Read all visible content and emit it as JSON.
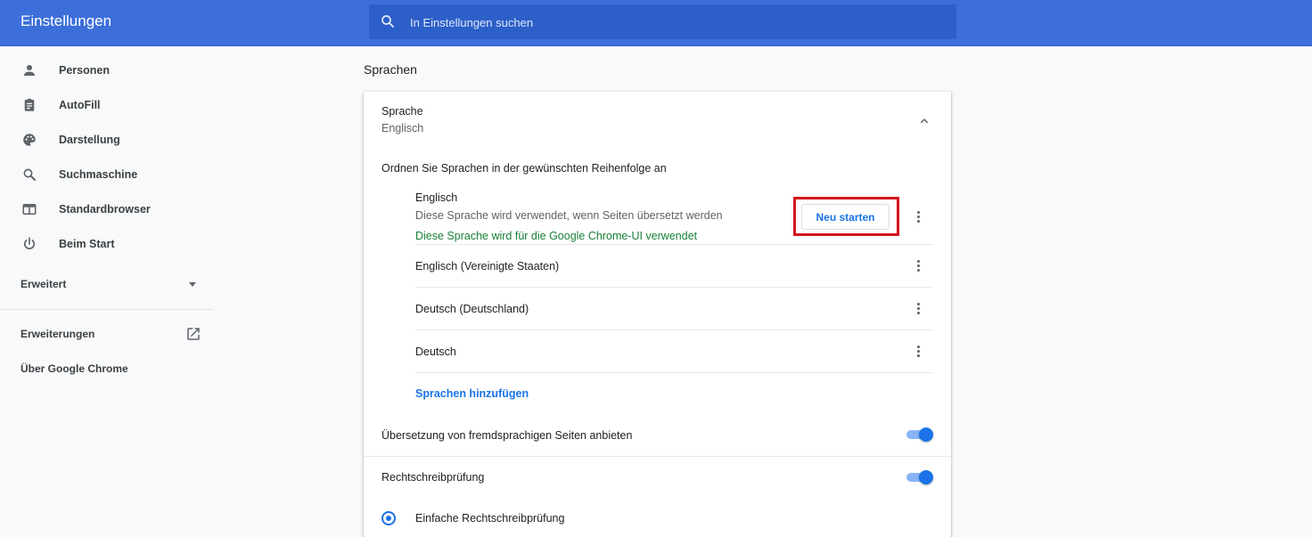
{
  "header": {
    "title": "Einstellungen",
    "search_placeholder": "In Einstellungen suchen"
  },
  "sidebar": {
    "items": [
      {
        "label": "Personen",
        "icon": "person-icon"
      },
      {
        "label": "AutoFill",
        "icon": "clipboard-icon"
      },
      {
        "label": "Darstellung",
        "icon": "palette-icon"
      },
      {
        "label": "Suchmaschine",
        "icon": "search-icon"
      },
      {
        "label": "Standardbrowser",
        "icon": "browser-window-icon"
      },
      {
        "label": "Beim Start",
        "icon": "power-icon"
      }
    ],
    "advanced": "Erweitert",
    "extensions": "Erweiterungen",
    "about": "Über Google Chrome"
  },
  "main": {
    "section_title": "Sprachen",
    "language_header": "Sprache",
    "language_value": "Englisch",
    "order_hint": "Ordnen Sie Sprachen in der gewünschten Reihenfolge an",
    "languages": [
      {
        "name": "Englisch",
        "desc": "Diese Sprache wird verwendet, wenn Seiten übersetzt werden",
        "ui_note": "Diese Sprache wird für die Google Chrome-UI verwendet",
        "restart_label": "Neu starten"
      },
      {
        "name": "Englisch (Vereinigte Staaten)"
      },
      {
        "name": "Deutsch (Deutschland)"
      },
      {
        "name": "Deutsch"
      }
    ],
    "add_languages": "Sprachen hinzufügen",
    "translate_offer": "Übersetzung von fremdsprachigen Seiten anbieten",
    "translate_offer_on": true,
    "spellcheck": "Rechtschreibprüfung",
    "spellcheck_on": true,
    "spellcheck_option": "Einfache Rechtschreibprüfung"
  },
  "colors": {
    "header_bg": "#3c6fd9",
    "accent": "#1a73e8",
    "highlight_box": "#d3151b",
    "ui_note_green": "#188038"
  }
}
